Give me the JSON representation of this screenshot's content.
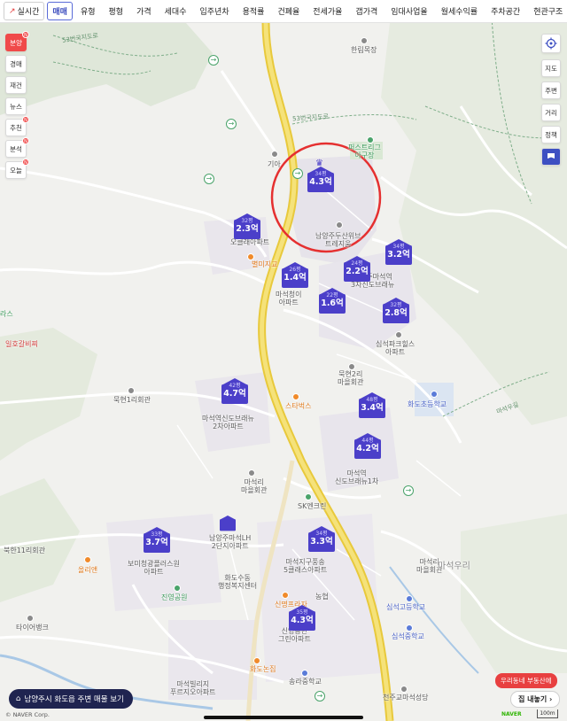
{
  "filter_bar": {
    "live_label": "실시간",
    "tabs": [
      {
        "label": "매매",
        "active": true
      },
      {
        "label": "유형"
      },
      {
        "label": "평형"
      },
      {
        "label": "가격"
      },
      {
        "label": "세대수"
      },
      {
        "label": "입주년차"
      },
      {
        "label": "용적률"
      },
      {
        "label": "건폐율"
      },
      {
        "label": "전세가율"
      },
      {
        "label": "갭가격"
      },
      {
        "label": "임대사업율"
      },
      {
        "label": "월세수익률"
      },
      {
        "label": "주차공간"
      },
      {
        "label": "현관구조"
      }
    ]
  },
  "left_menu": [
    {
      "label": "분양",
      "badge": "N",
      "hot": true
    },
    {
      "label": "경매"
    },
    {
      "label": "재건"
    },
    {
      "label": "뉴스"
    },
    {
      "label": "추천",
      "badge": "N"
    },
    {
      "label": "분석",
      "badge": "N"
    },
    {
      "label": "오늘",
      "badge": "N"
    }
  ],
  "right_tools": {
    "gps_icon": "crosshair-icon",
    "items": [
      "지도",
      "주변",
      "거리",
      "정책"
    ],
    "flag_icon": "flag-icon"
  },
  "markers": [
    {
      "size": "34평",
      "price": "4.3억",
      "crown": true
    },
    {
      "size": "32평",
      "price": "2.3억"
    },
    {
      "size": "26평",
      "price": "1.4억"
    },
    {
      "size": "24평",
      "price": "2.2억"
    },
    {
      "size": "34평",
      "price": "3.2억"
    },
    {
      "size": "22평",
      "price": "1.6억"
    },
    {
      "size": "32평",
      "price": "2.8억"
    },
    {
      "size": "42평",
      "price": "4.7억"
    },
    {
      "size": "48평",
      "price": "3.4억"
    },
    {
      "size": "44평",
      "price": "4.2억"
    },
    {
      "size": "33평",
      "price": "3.7억"
    },
    {
      "size": "34평",
      "price": "3.3억"
    },
    {
      "size": "35평",
      "price": "4.3억"
    }
  ],
  "map_labels": [
    "한림목장",
    "퍼스트리그\n아구장",
    "기아",
    "남양주두산위브\n트레지움",
    "오클래아파트",
    "별미지교",
    "남양주마석역\n3차신도브래뉴",
    "마석청이\n아파트",
    "심석파크힐스\n아파트",
    "묵현2리\n마을회관",
    "묵현1리회관",
    "스타벅스",
    "화도초등학교",
    "마석역신도브래뉴\n2차아파트",
    "마석역\n신도브래뉴1차",
    "마석리\n마을회관",
    "SK엔크린",
    "북한11리회관",
    "보미청광플러스원\n아파트",
    "올리앤",
    "남양주마석LH\n2단지아파트",
    "화도수동\n행정복지센터",
    "진영공원",
    "마석지구풍송\n5클래스아파트",
    "마석리\n마을회관",
    "타이어뱅크",
    "농협",
    "신명프라자",
    "신영공단\n그린아파트",
    "심석고등학교",
    "심석중학교",
    "화도논집",
    "송라중학교",
    "마석빌리지\n푸르지오아파트",
    "천주교마석성당",
    "마석우리",
    "일호갈비찌",
    "라스"
  ],
  "road_labels": [
    "53번국지도로",
    "마석우길"
  ],
  "bottom_banner": {
    "icon": "house-icon",
    "label": "남양주시 화도읍 주변 매물 보기"
  },
  "copyright": "© NAVER Corp.",
  "realtor_badge": "우리동네 부동산에",
  "sell_home_label": "집 내놓기",
  "sell_home_icon": "chevron-right-icon",
  "naver_logo": "NAVER",
  "scale_label": "100m",
  "colors": {
    "marker": "#4b3fc9",
    "highlight_circle": "#e53030",
    "road_yellow": "#f3d94d",
    "hot": "#f04a4a"
  }
}
